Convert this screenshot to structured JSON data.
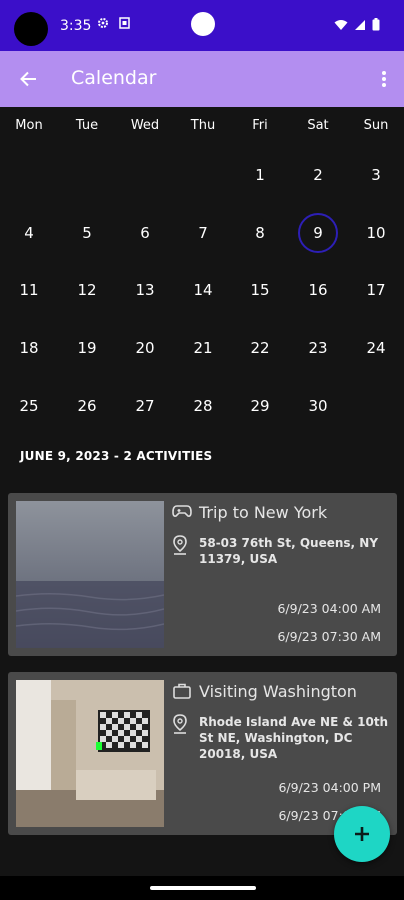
{
  "status_bar": {
    "time": "3:35",
    "left_icons": [
      "settings-gear-icon",
      "sim-card-icon"
    ],
    "right_icons": [
      "wifi-icon",
      "signal-icon",
      "battery-icon"
    ]
  },
  "app_bar": {
    "title": "Calendar",
    "back_icon": "arrow-back-icon",
    "menu_icon": "more-vert-icon"
  },
  "calendar": {
    "weekdays": [
      "Mon",
      "Tue",
      "Wed",
      "Thu",
      "Fri",
      "Sat",
      "Sun"
    ],
    "days": [
      "1",
      "2",
      "3",
      "4",
      "5",
      "6",
      "7",
      "8",
      "9",
      "10",
      "11",
      "12",
      "13",
      "14",
      "15",
      "16",
      "17",
      "18",
      "19",
      "20",
      "21",
      "22",
      "23",
      "24",
      "25",
      "26",
      "27",
      "28",
      "29",
      "30"
    ],
    "selected_day": "9",
    "selected_color": "#2d1fb6"
  },
  "summary": "JUNE 9, 2023 - 2 ACTIVITIES",
  "activities": [
    {
      "icon": "gamepad-icon",
      "title": "Trip to New York",
      "address": "58-03 76th St, Queens, NY 11379, USA",
      "start": "6/9/23  04:00 AM",
      "end": "6/9/23  07:30 AM"
    },
    {
      "icon": "briefcase-icon",
      "title": "Visiting Washington",
      "address": "Rhode Island Ave NE & 10th St NE, Washington, DC 20018, USA",
      "start": "6/9/23  04:00 PM",
      "end": "6/9/23  07:00 PM"
    }
  ],
  "fab": {
    "icon": "plus-icon",
    "color": "#1ed6c5"
  },
  "colors": {
    "status_bar": "#3b0fc9",
    "app_bar": "#b38ef0",
    "background": "#141414",
    "card": "#4a4a4a"
  }
}
